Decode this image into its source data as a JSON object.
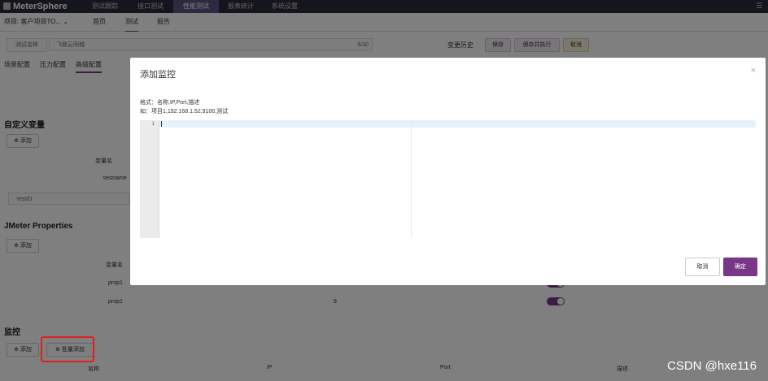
{
  "nav": {
    "logo": "MeterSphere",
    "items": [
      "测试跟踪",
      "接口测试",
      "性能测试",
      "报表统计",
      "系统设置"
    ]
  },
  "subbar": {
    "project": "项目: 客户项目TO...",
    "tabs": [
      "首页",
      "测试",
      "报告"
    ]
  },
  "test": {
    "name_label": "测试名称",
    "name_value": "飞致云同城",
    "name_count": "5/30",
    "history": "变更历史",
    "save": "保存",
    "save_run": "保存并执行",
    "cancel": "取消"
  },
  "config_tabs": [
    "场景配置",
    "压力配置",
    "高级配置"
  ],
  "variables": {
    "title": "自定义变量",
    "add": "添加",
    "header": "变量名",
    "row1": "testname",
    "row2": "testID"
  },
  "jmeter": {
    "title": "JMeter Properties",
    "add": "添加",
    "header": "变量名",
    "rows": [
      {
        "name": "prop1",
        "value": ""
      },
      {
        "name": "prop1",
        "value": "8"
      }
    ]
  },
  "monitor": {
    "title": "监控",
    "add": "添加",
    "batch_add": "批量添加",
    "columns": [
      "名称",
      "IP",
      "Port",
      "描述"
    ]
  },
  "modal": {
    "title": "添加监控",
    "hint1": "格式：名称,IP,Port,描述",
    "hint2": "如：项目1,192.168.1.52,9100,测试",
    "line_no": "1",
    "cancel": "取消",
    "confirm": "确定"
  },
  "watermark": "CSDN @hxe116",
  "colors": {
    "accent": "#783887",
    "nav_bg": "#2b2a3a"
  }
}
